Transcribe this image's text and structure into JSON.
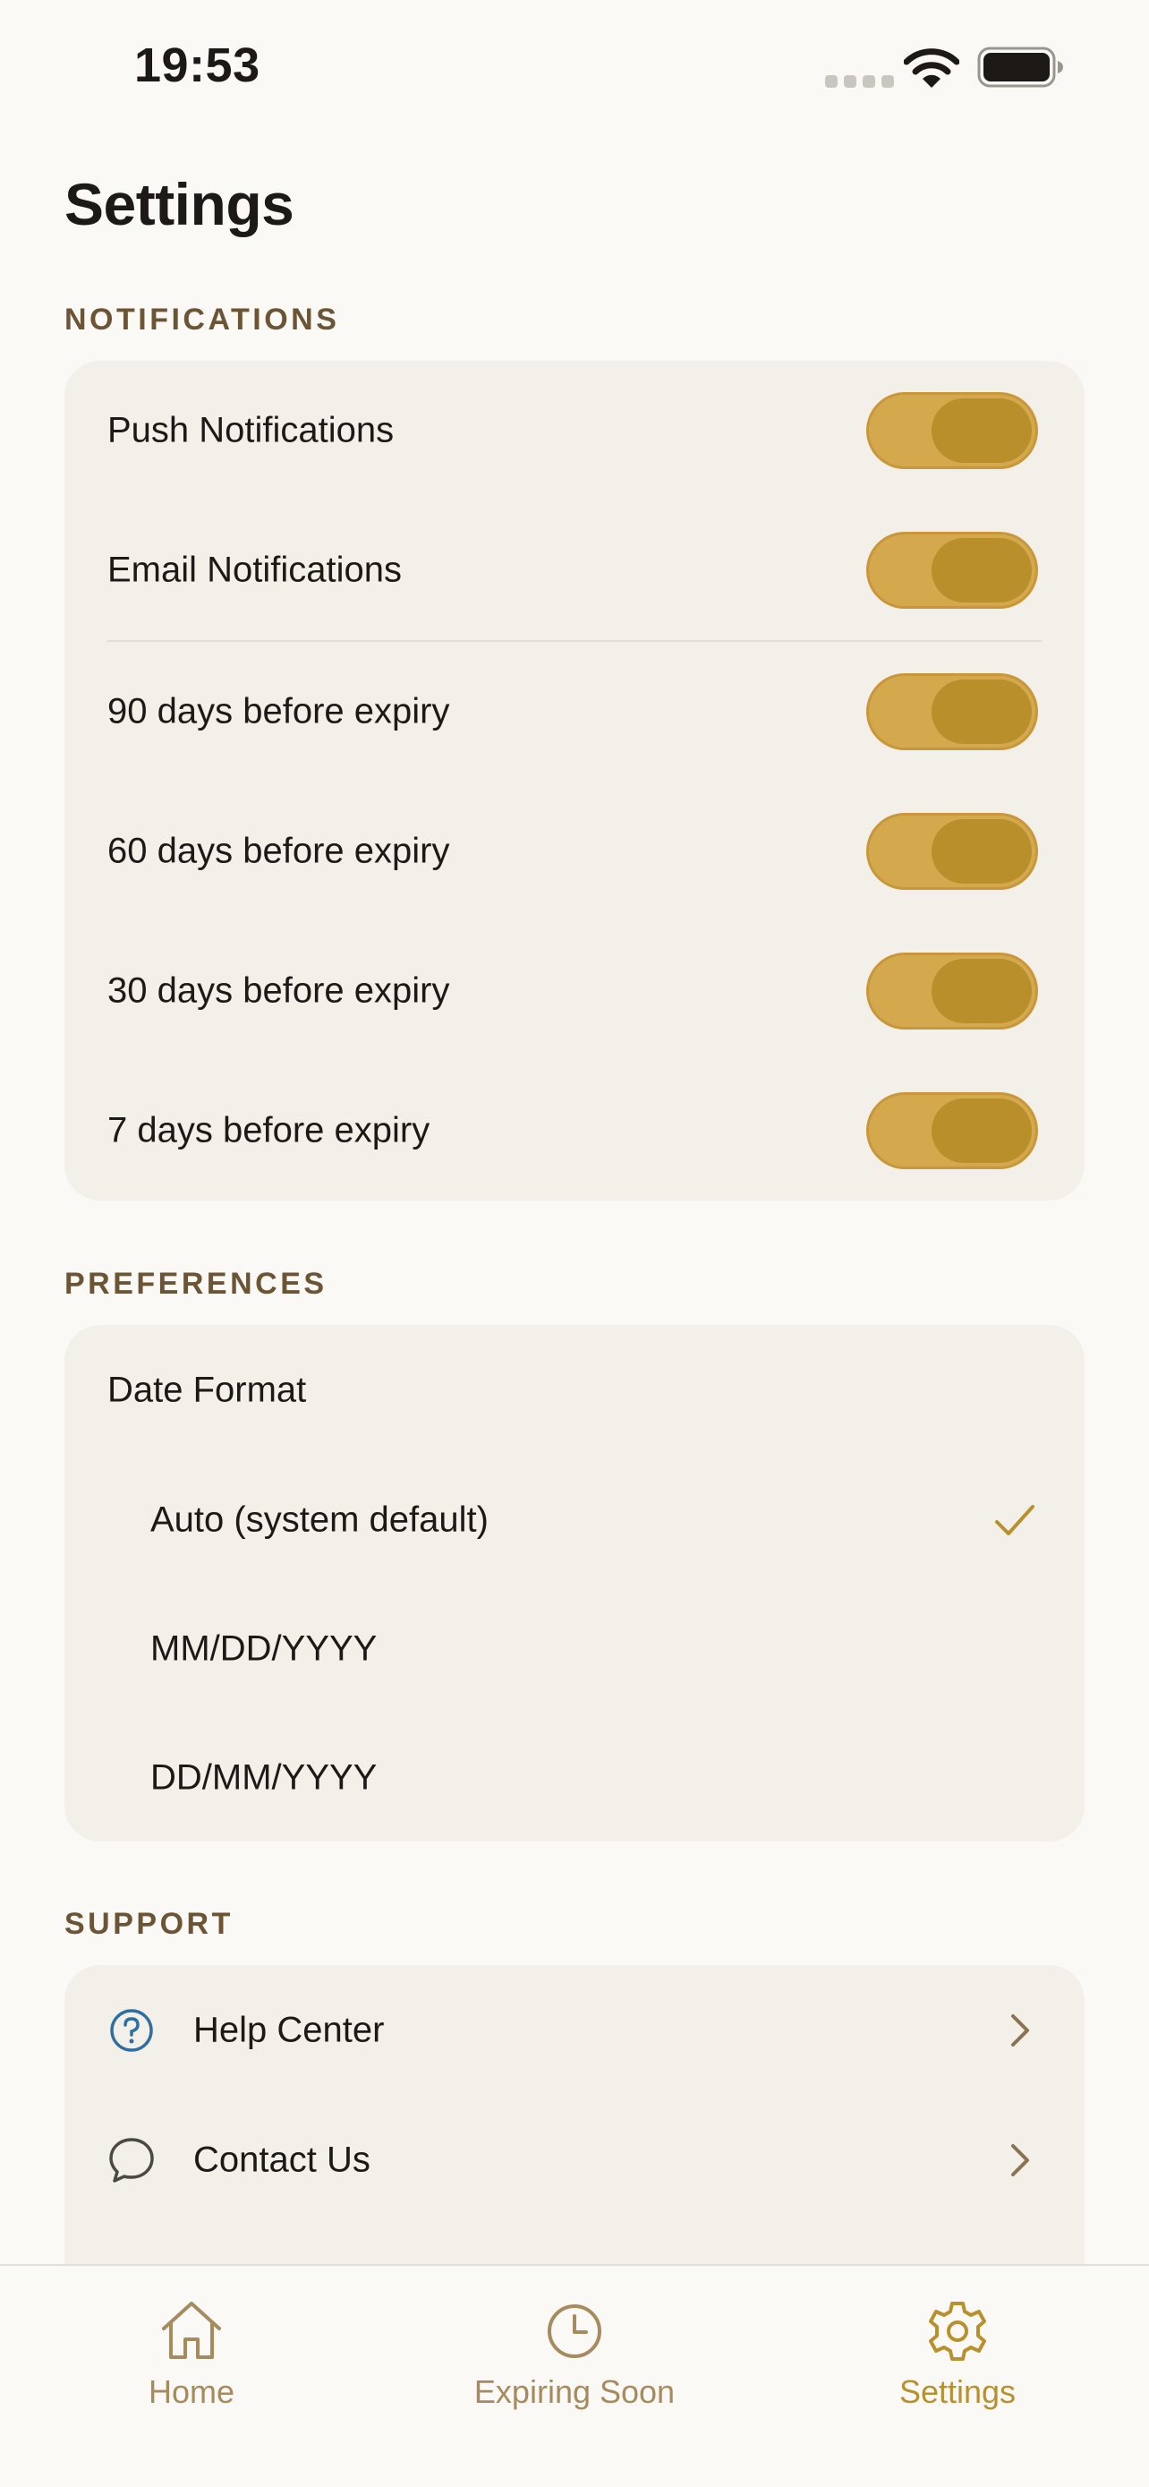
{
  "status_bar": {
    "time": "19:53"
  },
  "page": {
    "title": "Settings"
  },
  "notifications": {
    "header": "NOTIFICATIONS",
    "rows": [
      {
        "label": "Push Notifications",
        "enabled": true
      },
      {
        "label": "Email Notifications",
        "enabled": true
      },
      {
        "label": "90 days before expiry",
        "enabled": true
      },
      {
        "label": "60 days before expiry",
        "enabled": true
      },
      {
        "label": "30 days before expiry",
        "enabled": true
      },
      {
        "label": "7 days before expiry",
        "enabled": true
      }
    ]
  },
  "preferences": {
    "header": "PREFERENCES",
    "date_format_label": "Date Format",
    "options": [
      {
        "label": "Auto (system default)",
        "selected": true
      },
      {
        "label": "MM/DD/YYYY",
        "selected": false
      },
      {
        "label": "DD/MM/YYYY",
        "selected": false
      }
    ]
  },
  "support": {
    "header": "SUPPORT",
    "items": [
      {
        "label": "Help Center",
        "icon": "question-circle-icon"
      },
      {
        "label": "Contact Us",
        "icon": "chat-bubble-icon"
      }
    ]
  },
  "tab_bar": {
    "tabs": [
      {
        "label": "Home",
        "icon": "house-icon",
        "active": false
      },
      {
        "label": "Expiring Soon",
        "icon": "clock-icon",
        "active": false
      },
      {
        "label": "Settings",
        "icon": "gear-icon",
        "active": true
      }
    ]
  },
  "colors": {
    "accent": "#b8912e",
    "toggle_track": "#d4a84d",
    "toggle_knob": "#b98f2b",
    "section_header": "#6b5535",
    "card_background": "#f3f0ea",
    "page_background": "#faf9f6",
    "help_icon": "#2f6ea0"
  }
}
